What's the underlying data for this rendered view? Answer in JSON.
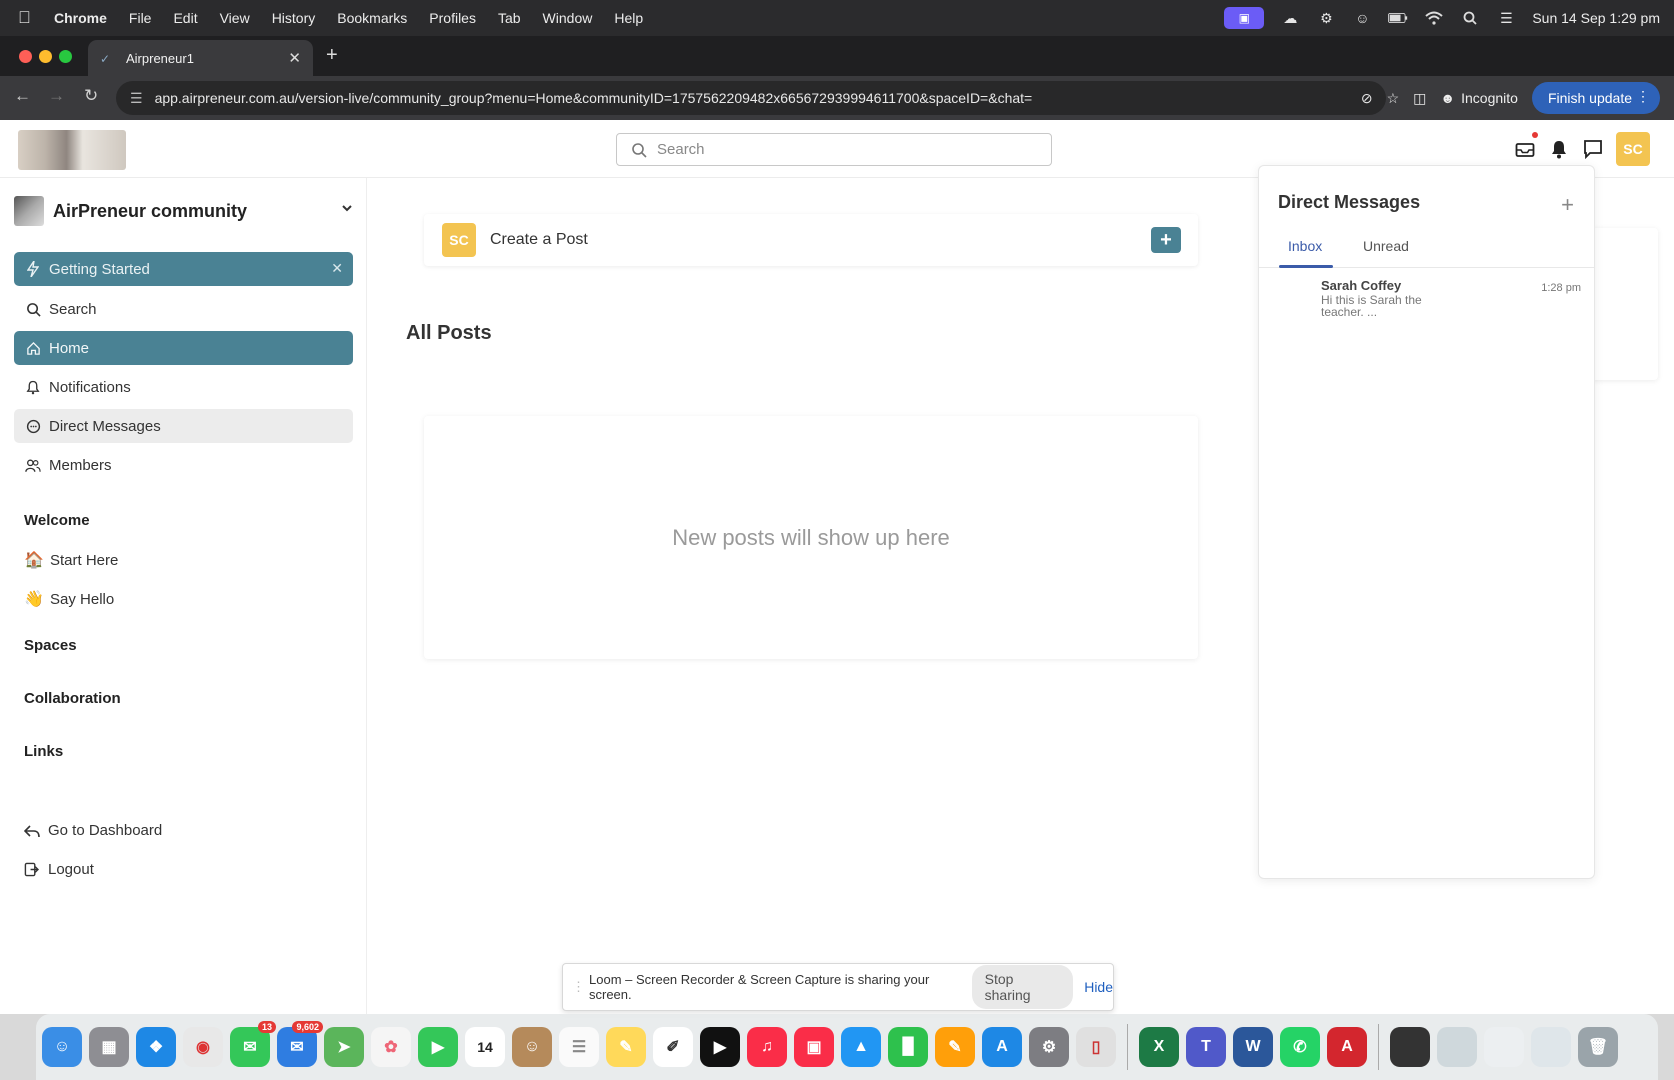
{
  "menubar": {
    "app": "Chrome",
    "items": [
      "File",
      "Edit",
      "View",
      "History",
      "Bookmarks",
      "Profiles",
      "Tab",
      "Window",
      "Help"
    ],
    "clock": "Sun 14 Sep  1:29 pm"
  },
  "browser": {
    "tab_title": "Airpreneur1",
    "url": "app.airpreneur.com.au/version-live/community_group?menu=Home&communityID=1757562209482x665672939994611700&spaceID=&chat=",
    "incognito_label": "Incognito",
    "finish_update_label": "Finish update"
  },
  "topbar": {
    "search_placeholder": "Search",
    "avatar_initials": "SC"
  },
  "sidebar": {
    "community_name": "AirPreneur community",
    "getting_started": "Getting Started",
    "nav": {
      "search": "Search",
      "home": "Home",
      "notifications": "Notifications",
      "direct_messages": "Direct Messages",
      "members": "Members"
    },
    "sections": {
      "welcome": "Welcome",
      "spaces": "Spaces",
      "collaboration": "Collaboration",
      "links": "Links"
    },
    "welcome_items": {
      "start_here": "Start Here",
      "say_hello": "Say Hello"
    },
    "footer": {
      "dashboard": "Go to Dashboard",
      "logout": "Logout"
    }
  },
  "main": {
    "create_post_avatar": "SC",
    "create_post_label": "Create a Post",
    "all_posts_title": "All Posts",
    "empty_message": "New posts will show up here"
  },
  "dm_panel": {
    "title": "Direct Messages",
    "tabs": {
      "inbox": "Inbox",
      "unread": "Unread"
    },
    "messages": [
      {
        "name": "Sarah Coffey",
        "preview": "Hi this is Sarah the teacher. ...",
        "time": "1:28 pm"
      }
    ]
  },
  "loom_banner": {
    "text": "Loom – Screen Recorder & Screen Capture is sharing your screen.",
    "stop_label": "Stop sharing",
    "hide_label": "Hide"
  },
  "dock": {
    "messages_badge": "13",
    "mail_badge": "9,602",
    "calendar_day": "14"
  },
  "colors": {
    "accent": "#4a8294",
    "avatar": "#f3c451",
    "dm_tab_active": "#3b5ba9"
  }
}
